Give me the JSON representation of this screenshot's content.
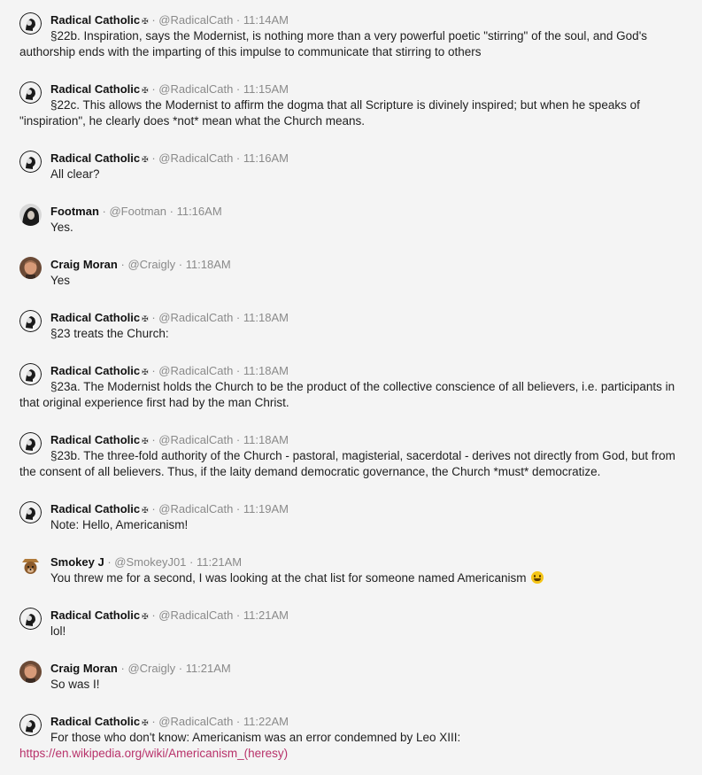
{
  "sep": "·",
  "cross": "✠",
  "messages": [
    {
      "name": "Radical Catholic",
      "handle": "@RadicalCath",
      "time": "11:14AM",
      "text": "§22b. Inspiration, says the Modernist, is nothing more than a very powerful poetic \"stirring\" of the soul, and God's authorship ends with the imparting of this impulse to communicate that stirring to others"
    },
    {
      "name": "Radical Catholic",
      "handle": "@RadicalCath",
      "time": "11:15AM",
      "text": "§22c. This allows the Modernist to affirm the dogma that all Scripture is divinely inspired; but when he speaks of \"inspiration\", he clearly does *not* mean what the Church means."
    },
    {
      "name": "Radical Catholic",
      "handle": "@RadicalCath",
      "time": "11:16AM",
      "text": "All clear?"
    },
    {
      "name": "Footman",
      "handle": "@Footman",
      "time": "11:16AM",
      "text": "Yes."
    },
    {
      "name": "Craig Moran",
      "handle": "@Craigly",
      "time": "11:18AM",
      "text": "Yes"
    },
    {
      "name": "Radical Catholic",
      "handle": "@RadicalCath",
      "time": "11:18AM",
      "text": "§23 treats the Church:"
    },
    {
      "name": "Radical Catholic",
      "handle": "@RadicalCath",
      "time": "11:18AM",
      "text": "§23a. The Modernist holds the Church to be the product of the collective conscience of all believers, i.e. participants in that original experience first had by the man Christ."
    },
    {
      "name": "Radical Catholic",
      "handle": "@RadicalCath",
      "time": "11:18AM",
      "text": "§23b. The three-fold authority of the Church - pastoral, magisterial, sacerdotal - derives not directly from God, but from the consent of all believers. Thus, if the laity demand democratic governance, the Church *must* democratize."
    },
    {
      "name": "Radical Catholic",
      "handle": "@RadicalCath",
      "time": "11:19AM",
      "text": "Note: Hello, Americanism!"
    },
    {
      "name": "Smokey J",
      "handle": "@SmokeyJ01",
      "time": "11:21AM",
      "text": "You threw me for a second, I was looking at the chat list for someone named Americanism"
    },
    {
      "name": "Radical Catholic",
      "handle": "@RadicalCath",
      "time": "11:21AM",
      "text": "lol!"
    },
    {
      "name": "Craig Moran",
      "handle": "@Craigly",
      "time": "11:21AM",
      "text": "So was I!"
    },
    {
      "name": "Radical Catholic",
      "handle": "@RadicalCath",
      "time": "11:22AM",
      "text": "For those who don't know: Americanism was an error condemned by Leo XIII:",
      "link": "https://en.wikipedia.org/wiki/Americanism_(heresy)"
    }
  ]
}
